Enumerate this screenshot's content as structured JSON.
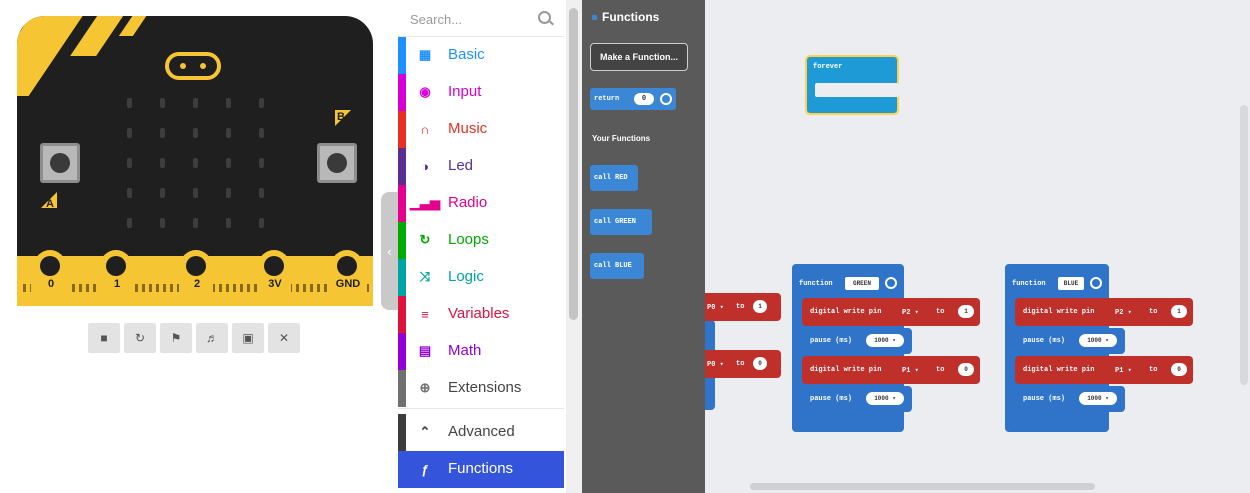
{
  "simulator": {
    "pin_labels": [
      "0",
      "1",
      "2",
      "3V",
      "GND"
    ],
    "button_labels": [
      "A",
      "B"
    ],
    "toolbar_icons": [
      "stop-icon",
      "restart-icon",
      "debug-icon",
      "sound-icon",
      "screenshot-icon",
      "close-icon"
    ]
  },
  "toolbox": {
    "search_placeholder": "Search...",
    "categories": [
      {
        "label": "Basic",
        "color": "#1e90ff",
        "icon": "grid-icon"
      },
      {
        "label": "Input",
        "color": "#d400d4",
        "icon": "input-icon"
      },
      {
        "label": "Music",
        "color": "#e63022",
        "icon": "headphones-icon"
      },
      {
        "label": "Led",
        "color": "#5c2d91",
        "icon": "toggle-icon"
      },
      {
        "label": "Radio",
        "color": "#e3008c",
        "icon": "signal-icon"
      },
      {
        "label": "Loops",
        "color": "#00aa00",
        "icon": "loop-icon"
      },
      {
        "label": "Logic",
        "color": "#00a4a6",
        "icon": "shuffle-icon"
      },
      {
        "label": "Variables",
        "color": "#dc143c",
        "icon": "list-icon"
      },
      {
        "label": "Math",
        "color": "#9400d3",
        "icon": "calculator-icon"
      },
      {
        "label": "Extensions",
        "color": "#707070",
        "icon": "plus-circle-icon"
      },
      {
        "label": "Advanced",
        "color": "#3c3c3c",
        "icon": "chevron-up-icon"
      },
      {
        "label": "Functions",
        "color": "#3455db",
        "icon": "function-icon"
      }
    ]
  },
  "flyout": {
    "title": "Functions",
    "make_function": "Make a Function...",
    "return_block": "return",
    "your_functions": "Your Functions",
    "calls": [
      "call RED",
      "call GREEN",
      "call BLUE"
    ]
  },
  "workspace": {
    "forever": "forever",
    "function1_name": "GREEN",
    "function2_name": "BLUE",
    "function_keyword": "function",
    "digital_write": "digital write pin",
    "pin_p2": "P2 ▾",
    "pin_p1": "P1 ▾",
    "to": "to",
    "pause": "pause (ms)",
    "pause_value": "1000 ▾",
    "value_1": "1",
    "value_0": "0",
    "partial_pin": "P0 ▾"
  }
}
